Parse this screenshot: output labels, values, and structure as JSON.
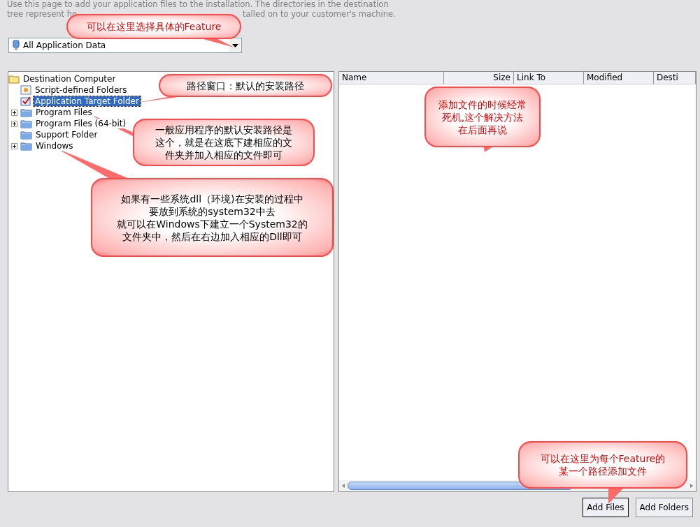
{
  "description": {
    "line1": "Use this page to add your application files to the installation. The directories in the destination",
    "line2_start": "tree represent ho",
    "line2_end": "talled on to your customer's machine."
  },
  "feature_dropdown": {
    "value": "All Application Data"
  },
  "tree": [
    {
      "label": "Destination Computer",
      "kind": "root",
      "selected": false,
      "expanded": true,
      "children": [
        {
          "label": "Script-defined Folders",
          "kind": "script",
          "selected": false
        },
        {
          "label": "Application Target Folder",
          "kind": "target",
          "selected": true
        },
        {
          "label": "Program Files",
          "kind": "folder",
          "selected": false,
          "expanded": false
        },
        {
          "label": "Program Files (64-bit)",
          "kind": "folder",
          "selected": false,
          "expanded": false
        },
        {
          "label": "Support Folder",
          "kind": "folder",
          "selected": false
        },
        {
          "label": "Windows",
          "kind": "folder",
          "selected": false,
          "expanded": false
        }
      ]
    }
  ],
  "file_table": {
    "columns": [
      "Name",
      "Size",
      "Link To",
      "Modified",
      "Desti"
    ]
  },
  "buttons": [
    "Add Files",
    "Add Folders"
  ],
  "callouts": [
    {
      "lines": [
        "可以在这里选择具体的Feature"
      ],
      "color": "#dd0000"
    },
    {
      "lines": [
        "路径窗口：默认的安装路径"
      ],
      "color": "#000000"
    },
    {
      "lines": [
        "一般应用程序的默认安装路径是",
        "这个，就是在这底下建相应的文",
        "件夹并加入相应的文件即可"
      ],
      "color": "#000000"
    },
    {
      "lines": [
        "如果有一些系统dll（环境)在安装的过程中",
        "要放到系统的system32中去",
        "就可以在Windows下建立一个System32的",
        "文件夹中，然后在右边加入相应的Dll即可"
      ],
      "color": "#000000"
    },
    {
      "lines": [
        "添加文件的时候经常",
        "死机,这个解决方法",
        "在后面再说"
      ],
      "color": "#dd0000"
    },
    {
      "lines": [
        "可以在这里为每个Feature的",
        "某一个路径添加文件"
      ],
      "color": "#dd0000"
    }
  ]
}
